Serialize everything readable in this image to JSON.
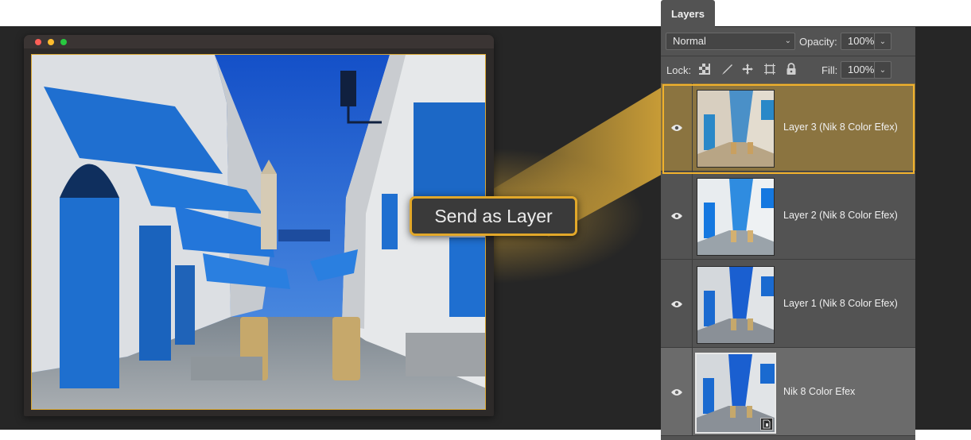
{
  "callout": {
    "label": "Send as Layer"
  },
  "layers_panel": {
    "tab_label": "Layers",
    "blend_mode": {
      "value": "Normal"
    },
    "opacity": {
      "label": "Opacity:",
      "value": "100%"
    },
    "lock": {
      "label": "Lock:",
      "icons": [
        "lock-transparent-pixels-icon",
        "lock-image-pixels-icon",
        "lock-position-icon",
        "lock-artboard-icon",
        "lock-all-icon"
      ]
    },
    "fill": {
      "label": "Fill:",
      "value": "100%"
    },
    "layers": [
      {
        "name": "Layer 3 (Nik 8 Color Efex)",
        "visible": true,
        "highlighted": true
      },
      {
        "name": "Layer 2 (Nik 8 Color Efex)",
        "visible": true
      },
      {
        "name": "Layer 1 (Nik 8 Color Efex)",
        "visible": true
      },
      {
        "name": "Nik 8 Color Efex",
        "visible": true,
        "smart_object": true,
        "selected": true
      }
    ]
  },
  "colors": {
    "accent": "#f0b12c",
    "panel_bg": "#535353",
    "dark_bg": "#262626"
  }
}
